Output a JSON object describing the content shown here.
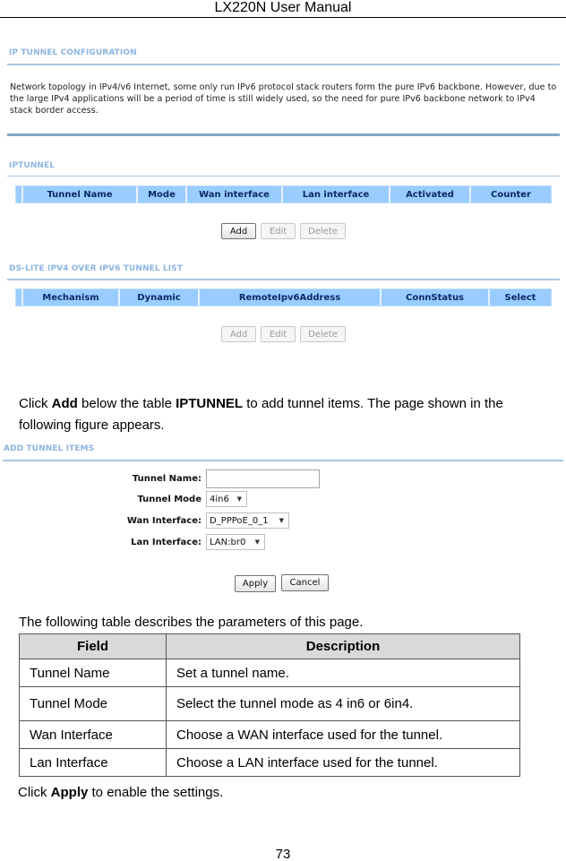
{
  "header": {
    "title": "LX220N User Manual"
  },
  "ip_tunnel_config": {
    "title": "IP TUNNEL CONFIGURATION",
    "description": "Network topology in IPv4/v6 Internet, some only run IPv6 protocol stack routers form the pure IPv6 backbone. However, due to the large IPv4 applications will be a period of time is still widely used, so the need for pure IPv6 backbone network to IPv4 stack border access."
  },
  "iptunnel": {
    "title": "IPTUNNEL",
    "columns": [
      "Tunnel Name",
      "Mode",
      "Wan interface",
      "Lan interface",
      "Activated",
      "Counter"
    ],
    "buttons": {
      "add": "Add",
      "edit": "Edit",
      "delete": "Delete"
    }
  },
  "dslite": {
    "title": "DS-LITE IPV4 OVER IPV6 TUNNEL LIST",
    "columns": [
      "Mechanism",
      "Dynamic",
      "RemoteIpv6Address",
      "ConnStatus",
      "Select"
    ],
    "buttons": {
      "add": "Add",
      "edit": "Edit",
      "delete": "Delete"
    }
  },
  "instruction": {
    "part1": "Click ",
    "bold1": "Add",
    "part2": " below the table ",
    "bold2": "IPTUNNEL",
    "part3": " to add tunnel items. The page shown in the following figure appears."
  },
  "add_tunnel": {
    "title": "ADD TUNNEL ITEMS",
    "fields": {
      "tunnel_name": {
        "label": "Tunnel Name:",
        "value": ""
      },
      "tunnel_mode": {
        "label": "Tunnel Mode",
        "value": "4in6"
      },
      "wan_interface": {
        "label": "Wan Interface:",
        "value": "D_PPPoE_0_1"
      },
      "lan_interface": {
        "label": "Lan Interface:",
        "value": "LAN:br0"
      }
    },
    "buttons": {
      "apply": "Apply",
      "cancel": "Cancel"
    }
  },
  "table_intro": "The following table describes the parameters of this page.",
  "params_table": {
    "headers": [
      "Field",
      "Description"
    ],
    "rows": [
      {
        "field": "Tunnel Name",
        "description": "Set a tunnel name."
      },
      {
        "field": "Tunnel Mode",
        "description": "Select the tunnel mode as 4 in6 or 6in4."
      },
      {
        "field": "Wan Interface",
        "description": "Choose a WAN interface used for the tunnel."
      },
      {
        "field": "Lan Interface",
        "description": "Choose a LAN interface used for the tunnel."
      }
    ]
  },
  "footer_note": {
    "part1": "Click ",
    "bold": "Apply",
    "part2": " to enable the settings."
  },
  "page_number": "73"
}
